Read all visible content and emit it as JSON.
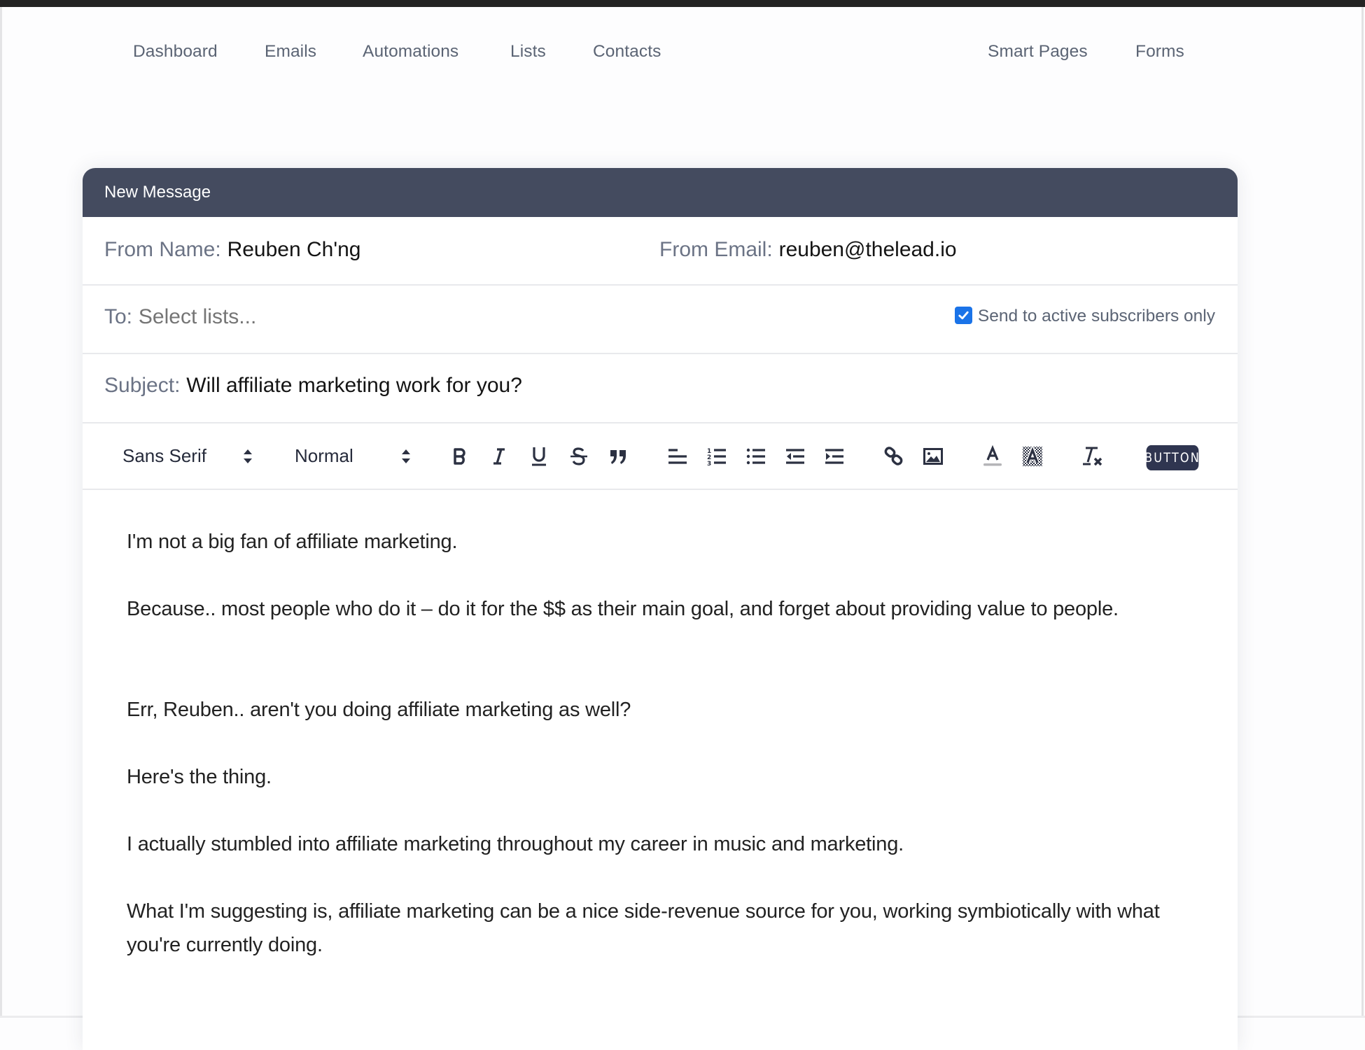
{
  "nav": {
    "left": [
      "Dashboard",
      "Emails",
      "Automations",
      "Lists",
      "Contacts"
    ],
    "right": [
      "Smart Pages",
      "Forms"
    ]
  },
  "composer": {
    "title": "New Message",
    "from_name_label": "From Name:",
    "from_name_value": "Reuben Ch'ng",
    "from_email_label": "From Email:",
    "from_email_value": "reuben@thelead.io",
    "to_label": "To:",
    "to_placeholder": "Select lists...",
    "active_only_label": "Send to active subscribers only",
    "active_only_checked": true,
    "subject_label": "Subject:",
    "subject_value": "Will affiliate marketing work for you?"
  },
  "toolbar": {
    "font_select": "Sans Serif",
    "size_select": "Normal",
    "icons": [
      "bold-icon",
      "italic-icon",
      "underline-icon",
      "strikethrough-icon",
      "blockquote-icon",
      "align-left-icon",
      "ordered-list-icon",
      "bullet-list-icon",
      "outdent-icon",
      "indent-icon",
      "link-icon",
      "image-icon",
      "text-color-icon",
      "background-color-icon",
      "clear-format-icon"
    ],
    "button_label": "BUTTON"
  },
  "body": {
    "paragraphs": [
      "I'm not a big fan of affiliate marketing.",
      "Because.. most people who do it – do it for the $$ as their main goal, and forget about providing value to people.",
      "Err, Reuben.. aren't you doing affiliate marketing as well?",
      "Here's the thing.",
      "I actually stumbled into affiliate marketing throughout my career in music and marketing.",
      "What I'm suggesting is, affiliate marketing can be a nice side-revenue source for you, working symbiotically with what you're currently doing."
    ]
  },
  "colors": {
    "header_bg": "#444b5f",
    "checkbox": "#1a73e8",
    "button_badge": "#2f3550"
  }
}
